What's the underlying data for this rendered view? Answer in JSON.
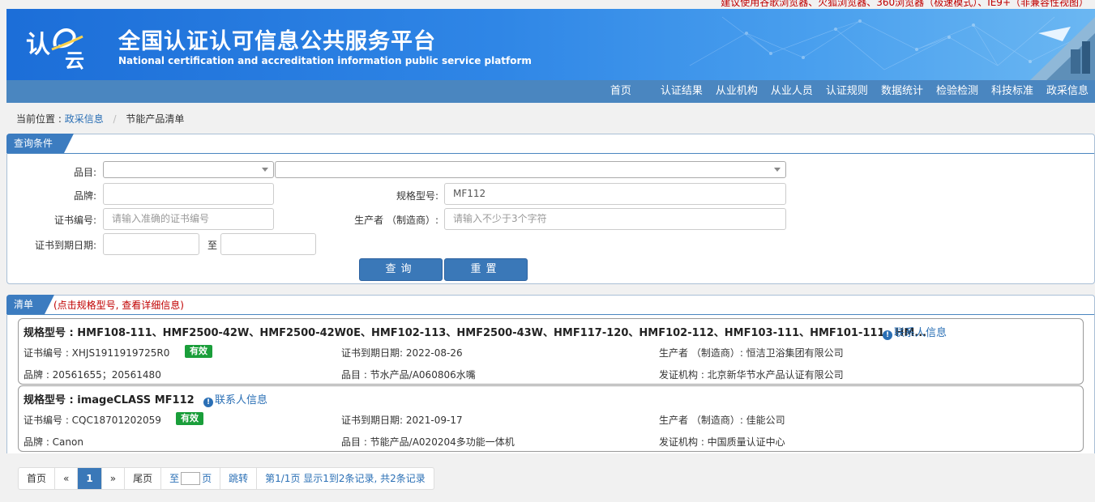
{
  "top_notice": "建议使用谷歌浏览器、火狐浏览器、360浏览器（极速模式）、IE9+（非兼容性视图）",
  "header": {
    "title": "全国认证认可信息公共服务平台",
    "subtitle": "National certification and accreditation information public service platform",
    "logo_text_1": "认",
    "logo_text_2": "云"
  },
  "nav": {
    "items": [
      "首页",
      "认证结果",
      "从业机构",
      "从业人员",
      "认证规则",
      "数据统计",
      "检验检测",
      "科技标准",
      "政采信息"
    ]
  },
  "breadcrumb": {
    "prefix": "当前位置 :",
    "parent": "政采信息",
    "separator": "/",
    "current": "节能产品清单"
  },
  "query": {
    "tab_label": "查询条件",
    "category_label": "品目:",
    "brand_label": "品牌:",
    "brand_value": "",
    "model_label": "规格型号:",
    "model_value": "MF112",
    "cert_label": "证书编号:",
    "cert_placeholder": "请输入准确的证书编号",
    "manufacturer_label": "生产者 （制造商）:",
    "manufacturer_placeholder": "请输入不少于3个字符",
    "expiry_label": "证书到期日期:",
    "expiry_to": "至",
    "search_button": "查询",
    "reset_button": "重置"
  },
  "list": {
    "tab_label": "清单",
    "hint": "(点击规格型号, 查看详细信息)",
    "contact_label": "联系人信息",
    "items": [
      {
        "title": "规格型号 : HMF108-111、HMF2500-42W、HMF2500-42W0E、HMF102-113、HMF2500-43W、HMF117-120、HMF102-112、HMF103-111、HMF101-111、HM...",
        "cert": "证书编号 : XHJS1911919725R0",
        "status": "有效",
        "expiry": "证书到期日期: 2022-08-26",
        "manufacturer": "生产者 （制造商）: 恒洁卫浴集团有限公司",
        "brand": "品牌 : 20561655；20561480",
        "category": "品目 : 节水产品/A060806水嘴",
        "issuer": "发证机构 : 北京新华节水产品认证有限公司"
      },
      {
        "title": "规格型号 : imageCLASS MF112",
        "cert": "证书编号 : CQC18701202059",
        "status": "有效",
        "expiry": "证书到期日期: 2021-09-17",
        "manufacturer": "生产者 （制造商）: 佳能公司",
        "brand": "品牌 : Canon",
        "category": "品目 : 节能产品/A020204多功能一体机",
        "issuer": "发证机构 : 中国质量认证中心"
      }
    ]
  },
  "pager": {
    "first": "首页",
    "prev": "«",
    "current": "1",
    "next": "»",
    "last": "尾页",
    "goto_prefix": "至",
    "goto_suffix": "页",
    "jump": "跳转",
    "info": "第1/1页  显示1到2条记录, 共2条记录"
  },
  "colors": {
    "header_blue": "#2f86e6",
    "nav_blue": "#4a86c0",
    "button_blue": "#3a78b8",
    "valid_green": "#1a9e3a",
    "notice_red": "#c00000"
  }
}
